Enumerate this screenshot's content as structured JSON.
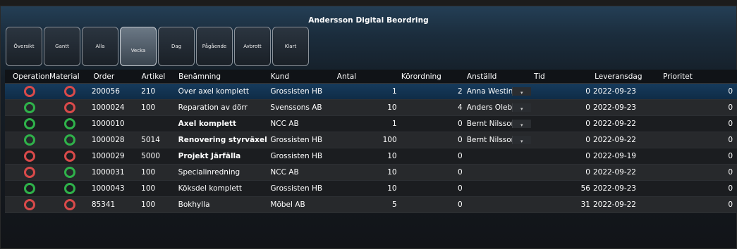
{
  "app": {
    "title": "Andersson Digital Beordring"
  },
  "toolbar": {
    "buttons": [
      {
        "label": "Översikt",
        "active": false
      },
      {
        "label": "Gantt",
        "active": false
      },
      {
        "label": "Alla",
        "active": false
      },
      {
        "label": "Vecka",
        "active": true
      },
      {
        "label": "Dag",
        "active": false
      },
      {
        "label": "Pågående",
        "active": false
      },
      {
        "label": "Avbrott",
        "active": false
      },
      {
        "label": "Klart",
        "active": false
      }
    ]
  },
  "table": {
    "columns": [
      "Operation",
      "Material",
      "Order",
      "Artikel",
      "Benämning",
      "Kund",
      "Antal",
      "Körordning",
      "Anställd",
      "Tid",
      "Leveransdag",
      "Prioritet"
    ],
    "rows": [
      {
        "operation": "red",
        "material": "red",
        "order": "200056",
        "artikel": "210",
        "benamning": "Över axel komplett",
        "kund": "Grossisten HB",
        "antal": "1",
        "korordning": "2",
        "anstalld": "Anna Westin",
        "tid": "0",
        "leveransdag": "2022-09-23",
        "prioritet": "0",
        "bold": false,
        "selected": true
      },
      {
        "operation": "green",
        "material": "red",
        "order": "1000024",
        "artikel": "100",
        "benamning": "Reparation av dörr",
        "kund": "Svenssons AB",
        "antal": "10",
        "korordning": "4",
        "anstalld": "Anders Oleby",
        "tid": "0",
        "leveransdag": "2022-09-23",
        "prioritet": "0",
        "bold": false,
        "selected": false
      },
      {
        "operation": "green",
        "material": "green",
        "order": "1000010",
        "artikel": "",
        "benamning": "Axel komplett",
        "kund": "NCC AB",
        "antal": "1",
        "korordning": "0",
        "anstalld": "Bernt Nilsson",
        "tid": "0",
        "leveransdag": "2022-09-22",
        "prioritet": "0",
        "bold": true,
        "selected": false
      },
      {
        "operation": "green",
        "material": "green",
        "order": "1000028",
        "artikel": "5014",
        "benamning": "Renovering styrväxel",
        "kund": "Grossisten HB",
        "antal": "100",
        "korordning": "0",
        "anstalld": "Bernt Nilsson",
        "tid": "0",
        "leveransdag": "2022-09-22",
        "prioritet": "0",
        "bold": true,
        "selected": false
      },
      {
        "operation": "red",
        "material": "red",
        "order": "1000029",
        "artikel": "5000",
        "benamning": "Projekt Järfälla",
        "kund": "Grossisten HB",
        "antal": "10",
        "korordning": "0",
        "anstalld": "",
        "tid": "0",
        "leveransdag": "2022-09-19",
        "prioritet": "0",
        "bold": true,
        "selected": false
      },
      {
        "operation": "red",
        "material": "green",
        "order": "1000031",
        "artikel": "100",
        "benamning": "Specialinredning",
        "kund": "NCC AB",
        "antal": "10",
        "korordning": "0",
        "anstalld": "",
        "tid": "0",
        "leveransdag": "2022-09-22",
        "prioritet": "0",
        "bold": false,
        "selected": false
      },
      {
        "operation": "green",
        "material": "green",
        "order": "1000043",
        "artikel": "100",
        "benamning": "Köksdel komplett",
        "kund": "Grossisten HB",
        "antal": "10",
        "korordning": "0",
        "anstalld": "",
        "tid": "56",
        "leveransdag": "2022-09-23",
        "prioritet": "0",
        "bold": false,
        "selected": false
      },
      {
        "operation": "red",
        "material": "red",
        "order": "85341",
        "artikel": "100",
        "benamning": "Bokhylla",
        "kund": "Möbel AB",
        "antal": "5",
        "korordning": "0",
        "anstalld": "",
        "tid": "31",
        "leveransdag": "2022-09-22",
        "prioritet": "0",
        "bold": false,
        "selected": false
      }
    ]
  },
  "icons": {
    "dropdown": "chevron-down-icon",
    "row_pointer": "row-selector-icon",
    "status": "status-ring-icon"
  },
  "colors": {
    "status_red": "#d94a4a",
    "status_green": "#2fb24a",
    "selection": "#163b5c"
  }
}
